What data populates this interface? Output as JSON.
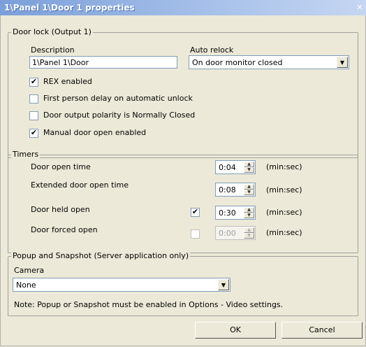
{
  "window": {
    "title": "1\\Panel 1\\Door 1 properties",
    "close_glyph": "✕"
  },
  "door_lock": {
    "legend": "Door lock (Output 1)",
    "description_label": "Description",
    "description_value": "1\\Panel 1\\Door",
    "auto_relock_label": "Auto relock",
    "auto_relock_value": "On door monitor closed",
    "checkboxes": [
      {
        "label": "REX enabled",
        "checked": true,
        "mark": "✔"
      },
      {
        "label": "First person delay on automatic unlock",
        "checked": false,
        "mark": ""
      },
      {
        "label": "Door output polarity is Normally Closed",
        "checked": false,
        "mark": ""
      },
      {
        "label": "Manual door open enabled",
        "checked": true,
        "mark": "✔"
      }
    ]
  },
  "timers": {
    "legend": "Timers",
    "rows": [
      {
        "label": "Door open time",
        "value": "0:04",
        "unit": "(min:sec)",
        "has_checkbox": false
      },
      {
        "label": "Extended  door open time",
        "value": "0:08",
        "unit": "(min:sec)",
        "has_checkbox": false
      },
      {
        "label": "Door held open",
        "value": "0:30",
        "unit": "(min:sec)",
        "has_checkbox": true,
        "checked": true,
        "mark": "✔"
      },
      {
        "label": "Door forced open",
        "value": "0:00",
        "unit": "(min:sec)",
        "has_checkbox": true,
        "checked": false,
        "mark": "",
        "disabled": true
      }
    ]
  },
  "popup": {
    "legend": "Popup and Snapshot  (Server application only)",
    "camera_label": "Camera",
    "camera_value": "None",
    "note": "Note: Popup or Snapshot must be enabled in Options - Video settings."
  },
  "buttons": {
    "ok": "OK",
    "cancel": "Cancel"
  },
  "icons": {
    "dropdown": "▼",
    "spin_up": "▲",
    "spin_down": "▼"
  },
  "colors": {
    "titlebar": "#7b9fd9",
    "dialog_bg": "#ece9d8",
    "field_border": "#7f9db9"
  }
}
